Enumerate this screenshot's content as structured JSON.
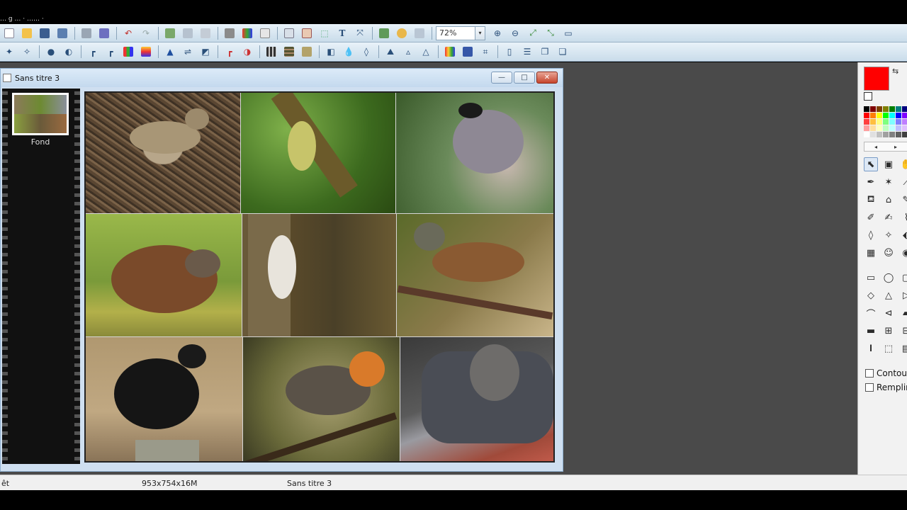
{
  "window_title_fragment": "… g … · …… ·",
  "toolbar": {
    "zoom_value": "72%",
    "zoom_dropdown_glyph": "▾",
    "row1_icons": [
      "new-icon",
      "open-icon",
      "save-icon",
      "save-as-icon",
      "print-icon",
      "scan-icon",
      "undo-icon",
      "redo-icon",
      "copy-icon",
      "paste-icon",
      "paste-new-icon",
      "crop-icon",
      "color-adjust-icon",
      "clear-icon",
      "text-insert-icon",
      "text-frame-icon",
      "select-rect-icon",
      "text-icon",
      "transform-icon",
      "layers-icon",
      "effects-icon",
      "browser-icon",
      "zoom-in-icon",
      "zoom-out-icon",
      "fit-window-icon",
      "actual-size-icon",
      "fullscreen-icon"
    ],
    "row2_icons": [
      "wand-add-icon",
      "wand-remove-icon",
      "brightness-icon",
      "contrast-icon",
      "levels-icon",
      "curves-icon",
      "rgb-icon",
      "hue-icon",
      "sharpen-icon",
      "rotate-icon",
      "flip-icon",
      "auto-levels-icon",
      "auto-contrast-icon",
      "filter-grid-icon",
      "filter-mosaic-icon",
      "filter-texture-icon",
      "filter-noise-icon",
      "drop-icon",
      "drop-outline-icon",
      "emboss-icon",
      "triangle-icon",
      "triangle-outline-icon",
      "gradient-icon",
      "monitor-icon",
      "crop-frame-icon",
      "book-icon",
      "stack-icon",
      "layers-copy-icon",
      "layers-paste-icon"
    ]
  },
  "document": {
    "title": "Sans titre 3",
    "minimize": "—",
    "maximize": "□",
    "close": "✕"
  },
  "filmstrip": {
    "layer_label": "Fond"
  },
  "collage": {
    "photos": [
      "skylark",
      "willow-warbler",
      "blackcap",
      "wren",
      "treecreeper",
      "dunnock",
      "blackbird",
      "robin",
      "black-redstart"
    ]
  },
  "right_panel": {
    "primary_color": "#ff0000",
    "secondary_color": "#ffffff",
    "swap_glyph": "⇆",
    "palette_nav_left": "◂",
    "palette_nav_right": "▸",
    "palette": [
      "#000000",
      "#7f0000",
      "#7f3f00",
      "#7f7f00",
      "#007f00",
      "#007f7f",
      "#00007f",
      "#ff0000",
      "#ff7f00",
      "#ffff00",
      "#00ff00",
      "#00ffff",
      "#0000ff",
      "#7f00ff",
      "#ff3f3f",
      "#ffbf3f",
      "#ffff7f",
      "#7fff7f",
      "#7fffff",
      "#7f7fff",
      "#bf7fff",
      "#ff9f9f",
      "#ffdf9f",
      "#ffffbf",
      "#bfffbf",
      "#bfffff",
      "#bfbfff",
      "#dfbfff",
      "#ffffff",
      "#e0e0e0",
      "#c0c0c0",
      "#a0a0a0",
      "#808080",
      "#606060",
      "#404040"
    ],
    "tool_glyphs": [
      "⬉",
      "▣",
      "✋",
      "✒",
      "✶",
      "⟋",
      "⛾",
      "⌂",
      "✎",
      "✐",
      "✍",
      "⌇",
      "◊",
      "✧",
      "⬖",
      "▦",
      "☺",
      "◉"
    ],
    "shape_glyphs": [
      "▭",
      "◯",
      "▢",
      "◇",
      "△",
      "▷",
      "⌒",
      "⊲",
      "▰",
      "▬",
      "⊞",
      "⊟",
      "𝐈",
      "⬚",
      "▤"
    ],
    "contour_label": "Contour",
    "fill_label": "Remplir"
  },
  "statusbar": {
    "left_text": "êt",
    "dimensions": "953x754x16M",
    "document_name": "Sans titre 3"
  }
}
